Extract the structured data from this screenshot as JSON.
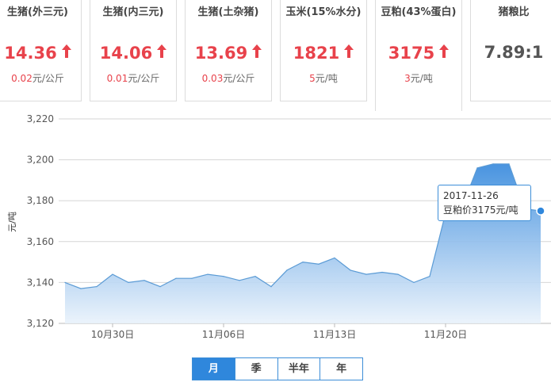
{
  "cards": [
    {
      "title": "生猪(外三元)",
      "price": "14.36",
      "change": "0.02",
      "unit": "元/公斤",
      "up": true
    },
    {
      "title": "生猪(内三元)",
      "price": "14.06",
      "change": "0.01",
      "unit": "元/公斤",
      "up": true
    },
    {
      "title": "生猪(土杂猪)",
      "price": "13.69",
      "change": "0.03",
      "unit": "元/公斤",
      "up": true
    },
    {
      "title": "玉米(15%水分)",
      "price": "1821",
      "change": "5",
      "unit": "元/吨",
      "up": true
    },
    {
      "title": "豆粕(43%蛋白)",
      "price": "3175",
      "change": "3",
      "unit": "元/吨",
      "up": true,
      "active": true
    },
    {
      "title": "猪粮比",
      "price": "7.89:1"
    }
  ],
  "tooltip": {
    "date": "2017-11-26",
    "label": "豆粕价3175元/吨"
  },
  "tabs": [
    {
      "label": "月",
      "active": true
    },
    {
      "label": "季",
      "active": false
    },
    {
      "label": "半年",
      "active": false
    },
    {
      "label": "年",
      "active": false
    }
  ],
  "colors": {
    "up": "#e8424b",
    "accent": "#2f87dc",
    "line": "#5b9bd5"
  },
  "chart_data": {
    "type": "area",
    "ylabel": "元/吨",
    "ylim": [
      3120,
      3220
    ],
    "yticks": [
      "3,120",
      "3,140",
      "3,160",
      "3,180",
      "3,200",
      "3,220"
    ],
    "xticks": [
      "10月30日",
      "11月06日",
      "11月13日",
      "11月20日"
    ],
    "grid": true,
    "series": [
      {
        "x": [
          "2017-10-27",
          "2017-10-28",
          "2017-10-29",
          "2017-10-30",
          "2017-10-31",
          "2017-11-01",
          "2017-11-02",
          "2017-11-03",
          "2017-11-04",
          "2017-11-05",
          "2017-11-06",
          "2017-11-07",
          "2017-11-08",
          "2017-11-09",
          "2017-11-10",
          "2017-11-11",
          "2017-11-12",
          "2017-11-13",
          "2017-11-14",
          "2017-11-15",
          "2017-11-16",
          "2017-11-17",
          "2017-11-18",
          "2017-11-19",
          "2017-11-20",
          "2017-11-21",
          "2017-11-22",
          "2017-11-23",
          "2017-11-24",
          "2017-11-25",
          "2017-11-26"
        ],
        "values": [
          3140,
          3137,
          3138,
          3144,
          3140,
          3141,
          3138,
          3142,
          3142,
          3144,
          3143,
          3141,
          3143,
          3138,
          3146,
          3150,
          3149,
          3152,
          3146,
          3144,
          3145,
          3144,
          3140,
          3143,
          3174,
          3176,
          3196,
          3198,
          3198,
          3176,
          3175
        ]
      }
    ]
  }
}
